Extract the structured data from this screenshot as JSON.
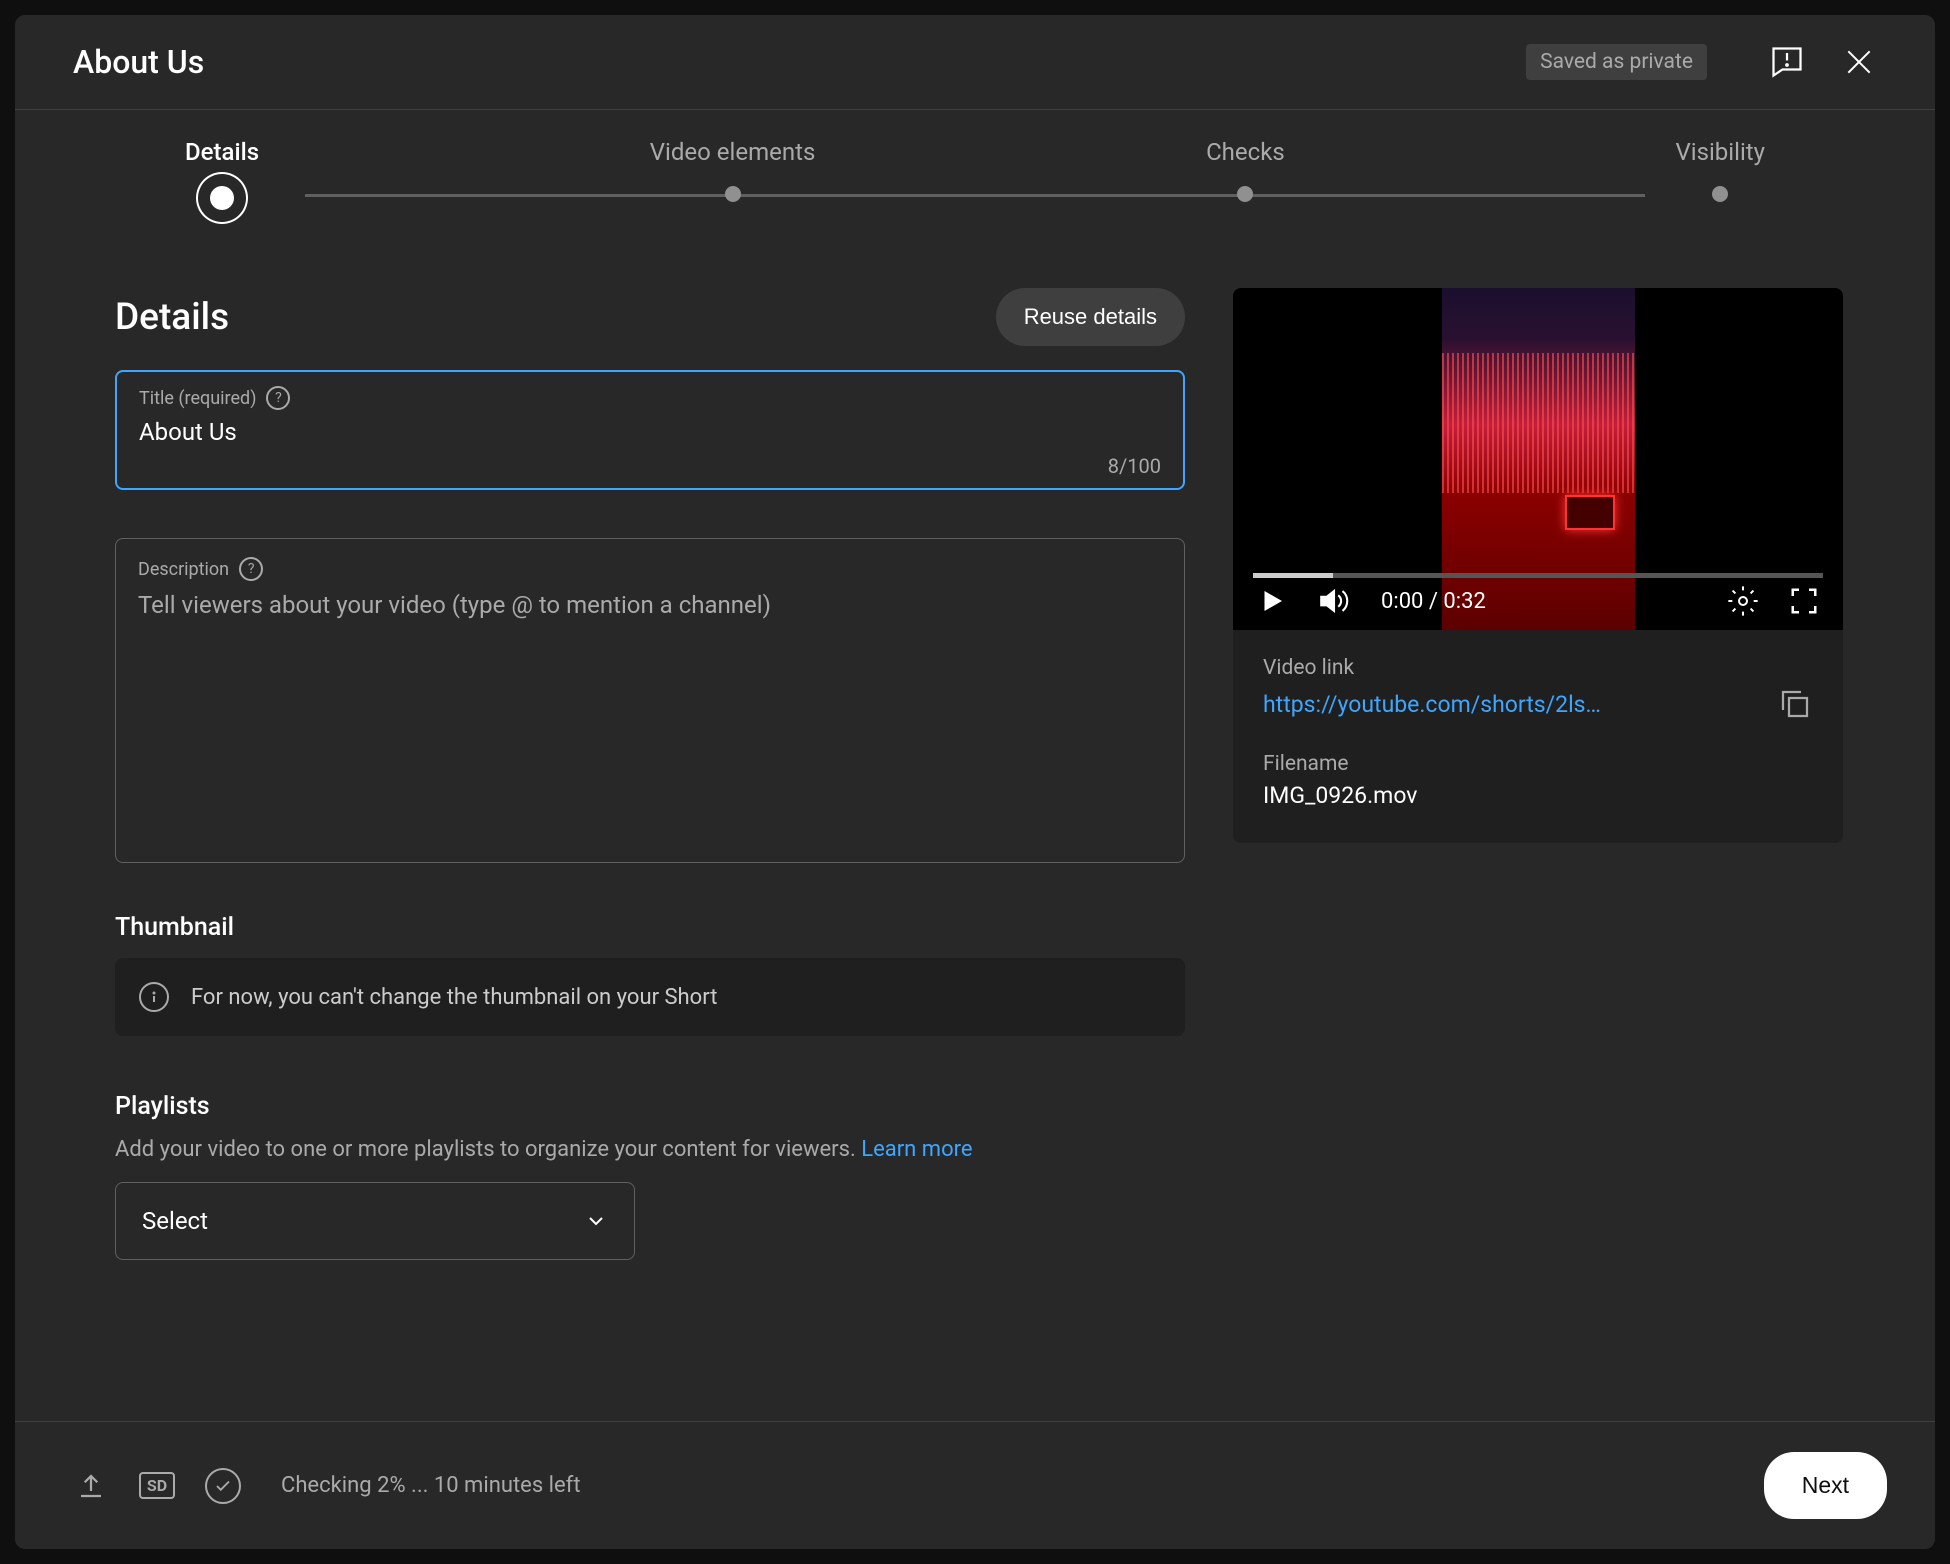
{
  "header": {
    "title": "About Us",
    "saved_status": "Saved as private"
  },
  "stepper": {
    "steps": [
      {
        "label": "Details",
        "active": true
      },
      {
        "label": "Video elements",
        "active": false
      },
      {
        "label": "Checks",
        "active": false
      },
      {
        "label": "Visibility",
        "active": false
      }
    ]
  },
  "details": {
    "heading": "Details",
    "reuse_button": "Reuse details",
    "title_field": {
      "label": "Title (required)",
      "value": "About Us",
      "char_count": "8/100"
    },
    "description_field": {
      "label": "Description",
      "placeholder": "Tell viewers about your video (type @ to mention a channel)"
    },
    "thumbnail": {
      "heading": "Thumbnail",
      "info_text": "For now, you can't change the thumbnail on your Short"
    },
    "playlists": {
      "heading": "Playlists",
      "body_text": "Add your video to one or more playlists to organize your content for viewers. ",
      "learn_more": "Learn more",
      "select_label": "Select"
    }
  },
  "video": {
    "time_current": "0:00",
    "time_total": "0:32",
    "link_label": "Video link",
    "link_url": "https://youtube.com/shorts/2ls…",
    "filename_label": "Filename",
    "filename_value": "IMG_0926.mov"
  },
  "footer": {
    "sd_label": "SD",
    "status_text": "Checking 2% ... 10 minutes left",
    "next_button": "Next"
  }
}
